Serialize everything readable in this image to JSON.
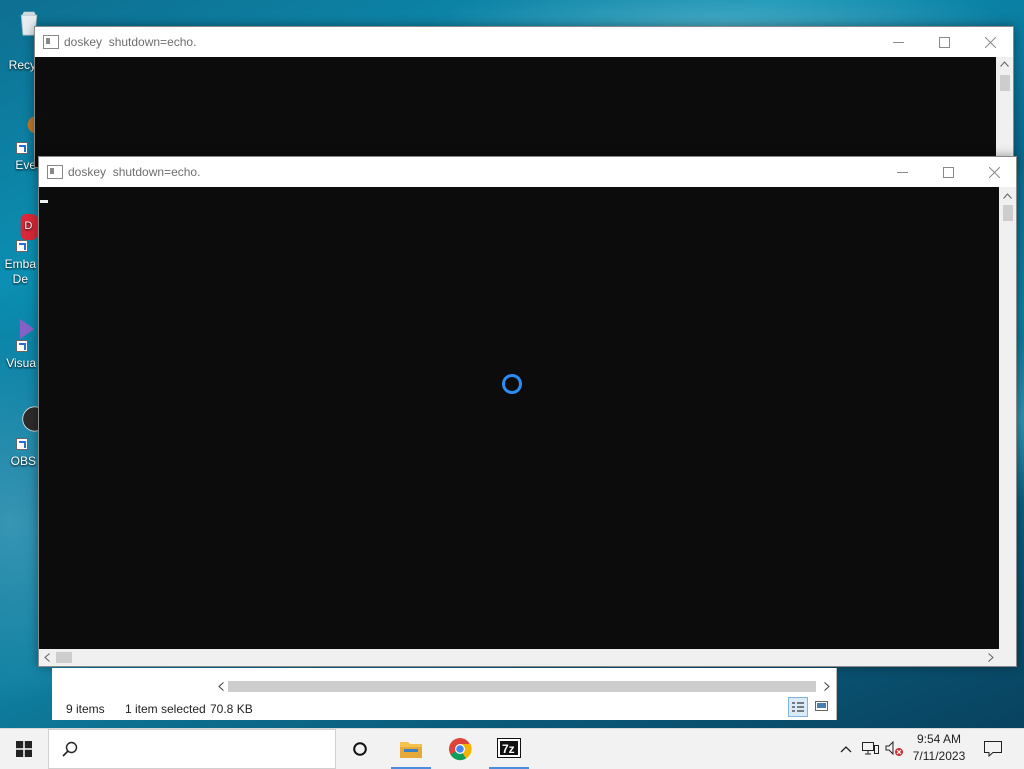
{
  "desktop": {
    "icons": [
      {
        "label": "Recy",
        "icon": "recycle-bin-icon"
      },
      {
        "label": "Eve",
        "icon": "shortcut-app-icon"
      },
      {
        "label": "Emba",
        "label2": "De",
        "icon": "embarcadero-icon"
      },
      {
        "label": "Visua",
        "icon": "visual-studio-icon"
      },
      {
        "label": "OBS",
        "icon": "obs-icon"
      }
    ]
  },
  "windows": {
    "back": {
      "title": "doskey  shutdown=echo."
    },
    "front": {
      "title": "doskey  shutdown=echo."
    }
  },
  "explorer": {
    "items_count": "9 items",
    "selection": "1 item selected",
    "size": "70.8 KB"
  },
  "taskbar": {
    "apps": [
      "cortana-circle-icon",
      "file-explorer-icon",
      "chrome-icon",
      "7zip-icon"
    ],
    "time": "9:54 AM",
    "date": "7/11/2023"
  },
  "colors": {
    "console_bg": "#0c0c0c",
    "spinner": "#2d8cf0",
    "accent": "#4c8de0"
  }
}
